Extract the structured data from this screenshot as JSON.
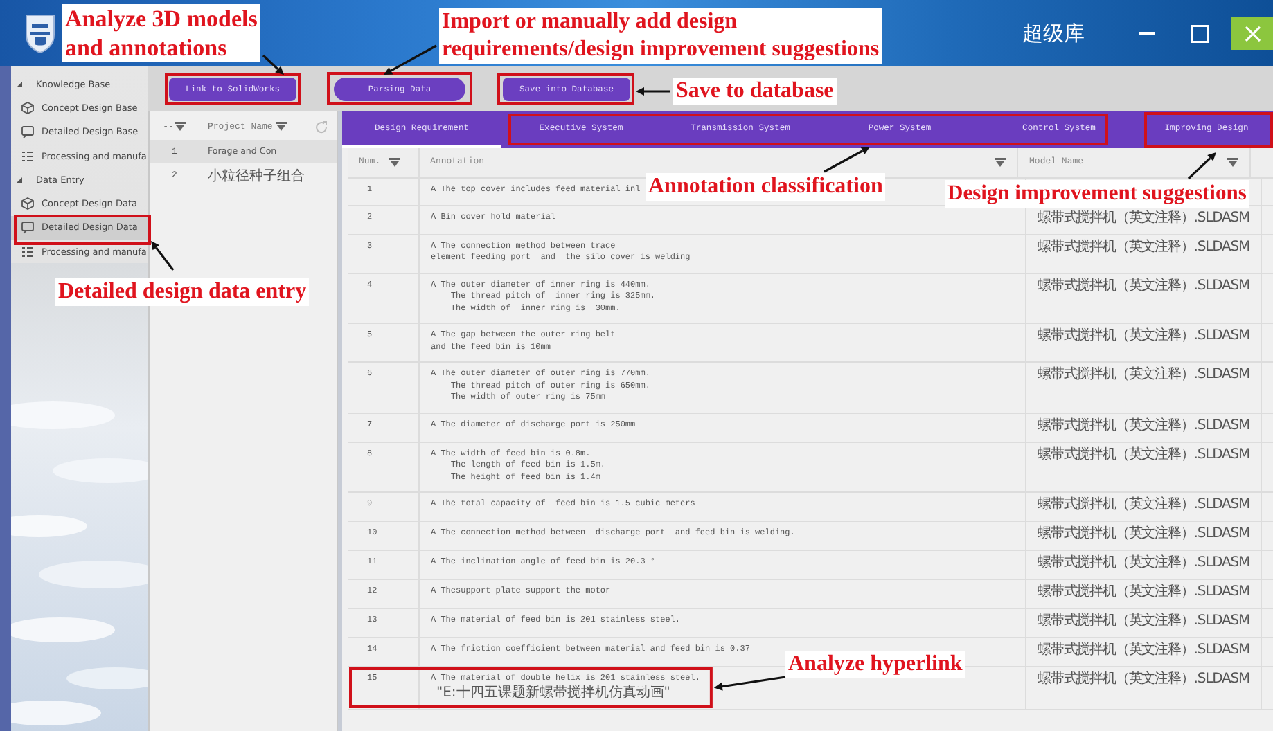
{
  "window": {
    "title": "超级库"
  },
  "toolbar": {
    "buttons": [
      {
        "label": "Link to SolidWorks"
      },
      {
        "label": "Parsing Data"
      },
      {
        "label": "Save into Database"
      }
    ]
  },
  "sidebar": {
    "items": [
      {
        "label": "Knowledge Base",
        "expanded": true,
        "children": [
          {
            "label": "Concept Design Base",
            "kind": "concept",
            "selected": false
          },
          {
            "label": "Detailed Design Base",
            "kind": "detailed",
            "selected": false
          },
          {
            "label": "Processing and manufa",
            "kind": "process",
            "selected": false
          }
        ]
      },
      {
        "label": "Data Entry",
        "expanded": true,
        "children": [
          {
            "label": "Concept Design Data",
            "kind": "concept",
            "selected": false
          },
          {
            "label": "Detailed Design Data",
            "kind": "detailed",
            "selected": true
          },
          {
            "label": "Processing and manufa",
            "kind": "process",
            "selected": false
          }
        ]
      }
    ]
  },
  "projects": {
    "columns": [
      "--",
      "Project Name"
    ],
    "rows": [
      {
        "num": "1",
        "name": "Forage and Con",
        "selected": true
      },
      {
        "num": "2",
        "name": "小粒径种子组合",
        "selected": false
      }
    ]
  },
  "tabs": [
    {
      "label": "Design Requirement",
      "selected": true
    },
    {
      "label": "Executive System",
      "selected": false
    },
    {
      "label": "Transmission System",
      "selected": false
    },
    {
      "label": "Power System",
      "selected": false
    },
    {
      "label": "Control System",
      "selected": false
    },
    {
      "label": "Improving Design",
      "selected": false
    }
  ],
  "table": {
    "columns": [
      "Num.",
      "Annotation",
      "Model Name"
    ],
    "rows": [
      {
        "num": "1",
        "lines": [
          "A The top cover includes feed material inl"
        ]
      },
      {
        "num": "2",
        "lines": [
          "A Bin cover hold material"
        ],
        "model": "螺带式搅拌机（英文注释）.SLDASM"
      },
      {
        "num": "3",
        "lines": [
          "A The connection method between trace",
          "element feeding port  and  the silo cover is welding"
        ],
        "model": "螺带式搅拌机（英文注释）.SLDASM"
      },
      {
        "num": "4",
        "lines": [
          "A The outer diameter of inner ring is 440mm.",
          "    The thread pitch of  inner ring is 325mm.",
          "    The width of  inner ring is  30mm."
        ],
        "model": "螺带式搅拌机（英文注释）.SLDASM"
      },
      {
        "num": "5",
        "lines": [
          "A The gap between the outer ring belt",
          "and the feed bin is 10mm"
        ],
        "model": "螺带式搅拌机（英文注释）.SLDASM"
      },
      {
        "num": "6",
        "lines": [
          "A The outer diameter of outer ring is 770mm.",
          "    The thread pitch of outer ring is 650mm.",
          "    The width of outer ring is 75mm"
        ],
        "model": "螺带式搅拌机（英文注释）.SLDASM"
      },
      {
        "num": "7",
        "lines": [
          "A The diameter of discharge port is 250mm"
        ],
        "model": "螺带式搅拌机（英文注释）.SLDASM"
      },
      {
        "num": "8",
        "lines": [
          "A The width of feed bin is 0.8m.",
          "    The length of feed bin is 1.5m.",
          "    The height of feed bin is 1.4m"
        ],
        "model": "螺带式搅拌机（英文注释）.SLDASM"
      },
      {
        "num": "9",
        "lines": [
          "A The total capacity of  feed bin is 1.5 cubic meters"
        ],
        "model": "螺带式搅拌机（英文注释）.SLDASM"
      },
      {
        "num": "10",
        "lines": [
          "A The connection method between  discharge port  and feed bin is welding."
        ],
        "model": "螺带式搅拌机（英文注释）.SLDASM"
      },
      {
        "num": "11",
        "lines": [
          "A The inclination angle of feed bin is 20.3 °"
        ],
        "model": "螺带式搅拌机（英文注释）.SLDASM"
      },
      {
        "num": "12",
        "lines": [
          "A Thesupport plate support the motor"
        ],
        "model": "螺带式搅拌机（英文注释）.SLDASM"
      },
      {
        "num": "13",
        "lines": [
          "A The material of feed bin is 201 stainless steel."
        ],
        "model": "螺带式搅拌机（英文注释）.SLDASM"
      },
      {
        "num": "14",
        "lines": [
          "A The friction coefficient between material and feed bin is 0.37"
        ],
        "model": "螺带式搅拌机（英文注释）.SLDASM"
      },
      {
        "num": "15",
        "lines": [
          "A The material of double helix is 201 stainless steel."
        ],
        "link": "\"E:十四五课题新螺带搅拌机仿真动画\"",
        "model": "螺带式搅拌机（英文注释）.SLDASM"
      }
    ]
  },
  "callouts": [
    "Analyze 3D models\nand annotations",
    "Import or manually add design\nrequirements/design improvement suggestions",
    "Save to database",
    "Annotation classification",
    "Design improvement suggestions",
    "Detailed design data entry",
    "Analyze hyperlink"
  ]
}
